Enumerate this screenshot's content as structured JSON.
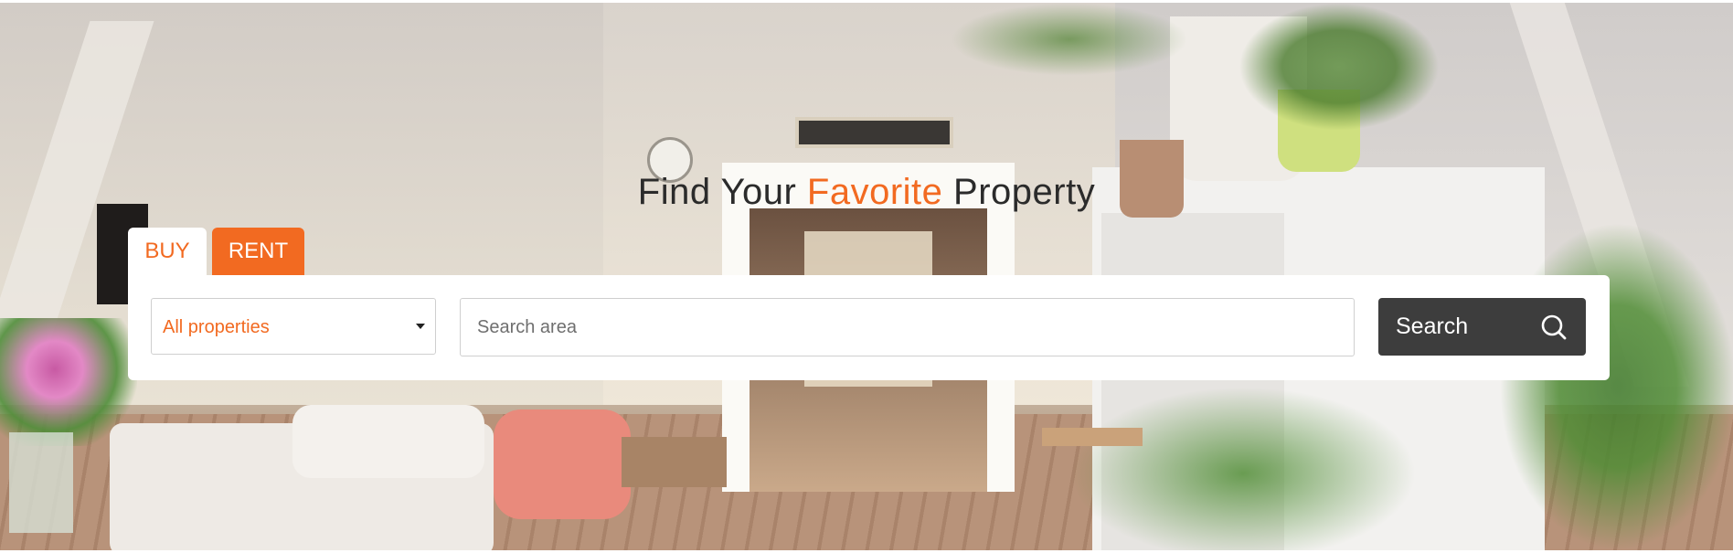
{
  "hero": {
    "title_before": "Find Your",
    "title_accent": "Favorite",
    "title_after": "Property"
  },
  "tabs": [
    {
      "label": "BUY",
      "active": true
    },
    {
      "label": "RENT",
      "active": false
    }
  ],
  "search_form": {
    "property_type": {
      "selected": "All properties"
    },
    "area": {
      "placeholder": "Search area",
      "value": ""
    },
    "submit_label": "Search"
  },
  "colors": {
    "accent": "#f26a21",
    "button_dark": "#3d3d3d",
    "title_text": "#2b2b2b"
  },
  "icons": {
    "search_button": "search-icon",
    "select_caret": "caret-down-icon"
  }
}
